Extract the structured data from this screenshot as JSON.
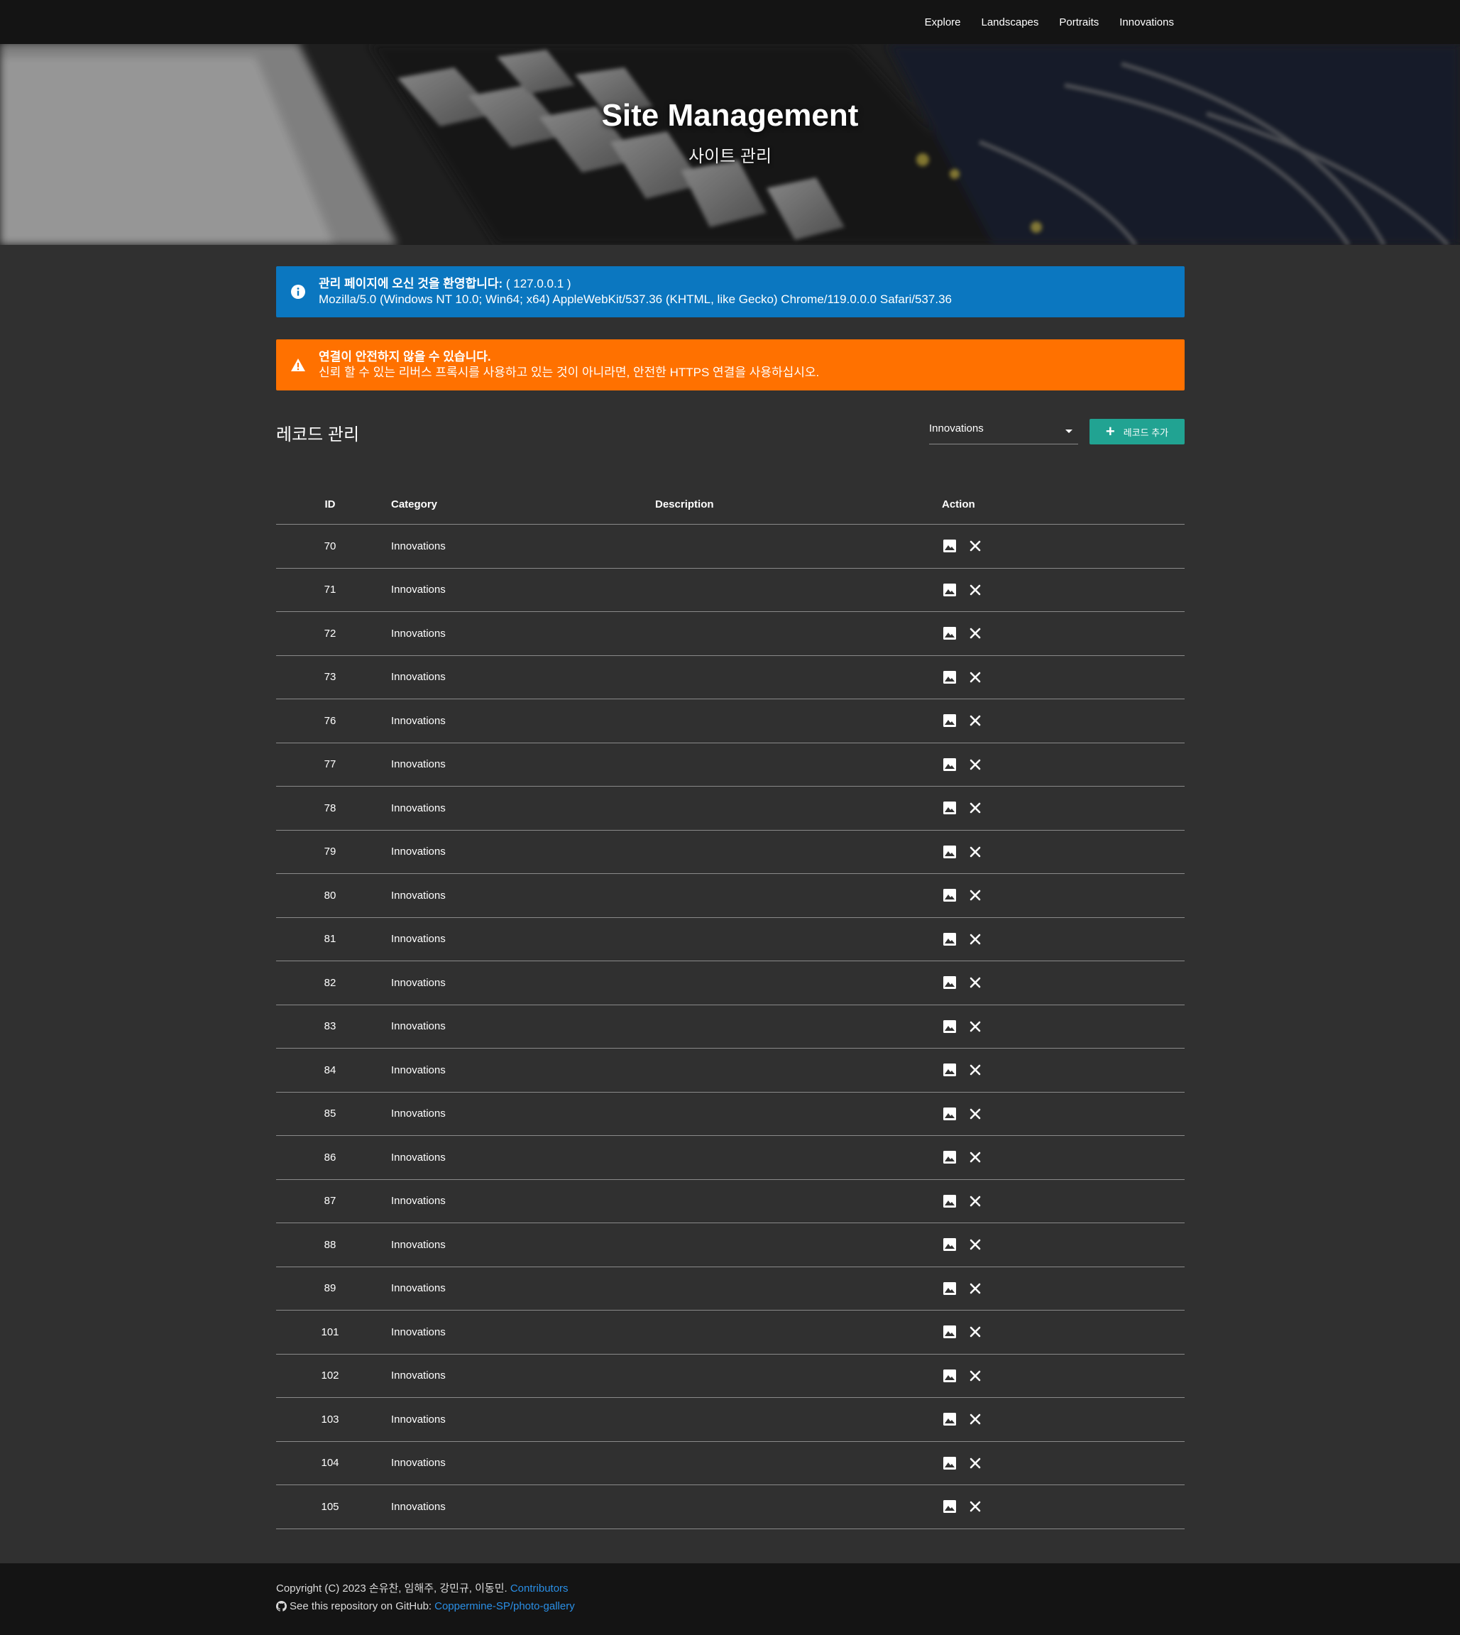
{
  "nav": {
    "items": [
      "Explore",
      "Landscapes",
      "Portraits",
      "Innovations"
    ]
  },
  "hero": {
    "title": "Site Management",
    "subtitle": "사이트 관리"
  },
  "alerts": {
    "info": {
      "strong": "관리 페이지에 오신 것을 환영합니다:",
      "ip": " ( 127.0.0.1 )",
      "user_agent": "Mozilla/5.0 (Windows NT 10.0; Win64; x64) AppleWebKit/537.36 (KHTML, like Gecko) Chrome/119.0.0.0 Safari/537.36",
      "color": "#0b77c0",
      "icon": "info-icon"
    },
    "warning": {
      "strong": "연결이 안전하지 않을 수 있습니다.",
      "text": "신뢰 할 수 있는 리버스 프록시를 사용하고 있는 것이 아니라면, 안전한 HTTPS 연결을 사용하십시오.",
      "color": "#ff7100",
      "icon": "warning-icon"
    }
  },
  "records": {
    "title": "레코드 관리",
    "select_value": "Innovations",
    "add_label": "레코드 추가",
    "accent": "#21a392",
    "columns": [
      "ID",
      "Category",
      "Description",
      "Action"
    ],
    "rows": [
      {
        "id": "70",
        "category": "Innovations",
        "description": ""
      },
      {
        "id": "71",
        "category": "Innovations",
        "description": ""
      },
      {
        "id": "72",
        "category": "Innovations",
        "description": ""
      },
      {
        "id": "73",
        "category": "Innovations",
        "description": ""
      },
      {
        "id": "76",
        "category": "Innovations",
        "description": ""
      },
      {
        "id": "77",
        "category": "Innovations",
        "description": ""
      },
      {
        "id": "78",
        "category": "Innovations",
        "description": ""
      },
      {
        "id": "79",
        "category": "Innovations",
        "description": ""
      },
      {
        "id": "80",
        "category": "Innovations",
        "description": ""
      },
      {
        "id": "81",
        "category": "Innovations",
        "description": ""
      },
      {
        "id": "82",
        "category": "Innovations",
        "description": ""
      },
      {
        "id": "83",
        "category": "Innovations",
        "description": ""
      },
      {
        "id": "84",
        "category": "Innovations",
        "description": ""
      },
      {
        "id": "85",
        "category": "Innovations",
        "description": ""
      },
      {
        "id": "86",
        "category": "Innovations",
        "description": ""
      },
      {
        "id": "87",
        "category": "Innovations",
        "description": ""
      },
      {
        "id": "88",
        "category": "Innovations",
        "description": ""
      },
      {
        "id": "89",
        "category": "Innovations",
        "description": ""
      },
      {
        "id": "101",
        "category": "Innovations",
        "description": ""
      },
      {
        "id": "102",
        "category": "Innovations",
        "description": ""
      },
      {
        "id": "103",
        "category": "Innovations",
        "description": ""
      },
      {
        "id": "104",
        "category": "Innovations",
        "description": ""
      },
      {
        "id": "105",
        "category": "Innovations",
        "description": ""
      }
    ],
    "row_icons": [
      "image-icon",
      "close-icon"
    ]
  },
  "footer": {
    "copyright": "Copyright (C) 2023 손유찬, 임해주, 강민규, 이동민.",
    "contributors_label": "Contributors",
    "repo_prefix": "See this repository on GitHub:",
    "repo_link": "Coppermine-SP/photo-gallery",
    "link_color": "#2a8fe6"
  }
}
